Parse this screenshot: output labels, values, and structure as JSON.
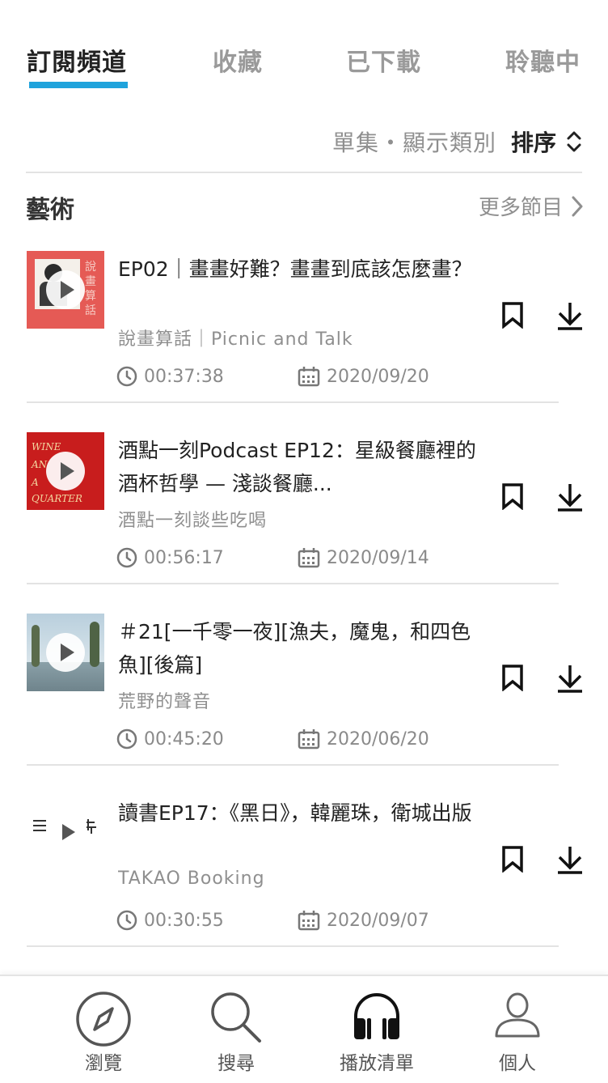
{
  "tabs": [
    {
      "label": "訂閱頻道",
      "active": true
    },
    {
      "label": "收藏",
      "active": false
    },
    {
      "label": "已下載",
      "active": false
    },
    {
      "label": "聆聽中",
      "active": false
    }
  ],
  "filter": {
    "label": "單集・顯示類別",
    "sort_label": "排序"
  },
  "section": {
    "title": "藝術",
    "more_label": "更多節目"
  },
  "episodes": [
    {
      "title": "EP02｜畫畫好難？畫畫到底該怎麼畫？",
      "show": "說畫算話｜Picnic and Talk",
      "duration": "00:37:38",
      "date": "2020/09/20",
      "thumb_color": "#e55a55"
    },
    {
      "title": "酒點一刻Podcast EP12：星級餐廳裡的酒杯哲學 — 淺談餐廳...",
      "show": "酒點一刻談些吃喝",
      "duration": "00:56:17",
      "date": "2020/09/14",
      "thumb_color": "#c81d1d"
    },
    {
      "title": "＃21[一千零一夜][漁夫，魔鬼，和四色魚][後篇]",
      "show": "荒野的聲音",
      "duration": "00:45:20",
      "date": "2020/06/20",
      "thumb_color": "#9ab5c8"
    },
    {
      "title": "讀書EP17：《黑日》，韓麗珠，衛城出版",
      "show": "TAKAO Booking",
      "duration": "00:30:55",
      "date": "2020/09/07",
      "thumb_color": "#ffffff"
    }
  ],
  "bottom_nav": [
    {
      "label": "瀏覽",
      "icon": "compass-icon",
      "active": false
    },
    {
      "label": "搜尋",
      "icon": "search-icon",
      "active": false
    },
    {
      "label": "播放清單",
      "icon": "headphones-icon",
      "active": true
    },
    {
      "label": "個人",
      "icon": "person-icon",
      "active": false
    }
  ],
  "colors": {
    "accent": "#1fa3dc",
    "text_primary": "#222222",
    "text_secondary": "#8f8f8f"
  }
}
